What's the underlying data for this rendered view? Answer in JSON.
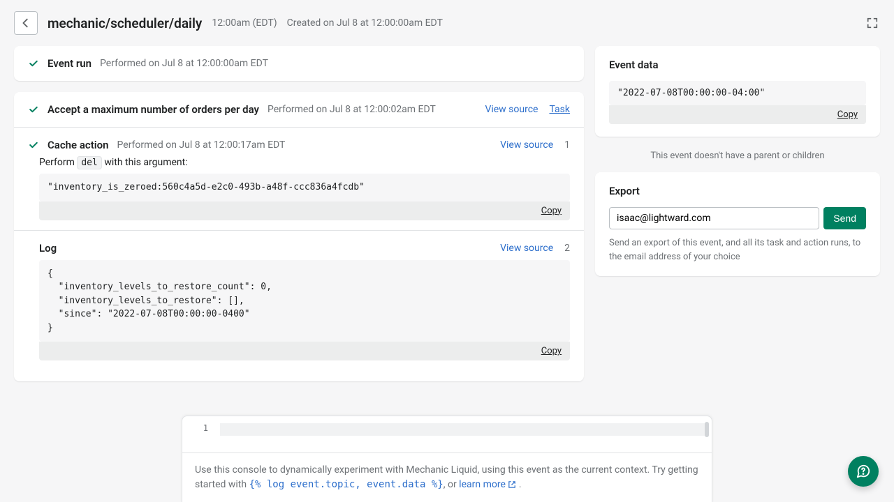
{
  "header": {
    "title": "mechanic/scheduler/daily",
    "time": "12:00am (EDT)",
    "created": "Created on Jul 8 at 12:00:00am EDT"
  },
  "event_run": {
    "title": "Event run",
    "performed": "Performed on Jul 8 at 12:00:00am EDT"
  },
  "task_run": {
    "title": "Accept a maximum number of orders per day",
    "performed": "Performed on Jul 8 at 12:00:02am EDT",
    "view_source": "View source",
    "task_link": "Task"
  },
  "cache_action": {
    "title": "Cache action",
    "performed": "Performed on Jul 8 at 12:00:17am EDT",
    "view_source": "View source",
    "count": "1",
    "arg_prefix": "Perform ",
    "arg_op": "del",
    "arg_suffix": " with this argument:",
    "arg_value": "\"inventory_is_zeroed:560c4a5d-e2c0-493b-a48f-ccc836a4fcdb\"",
    "copy": "Copy"
  },
  "log": {
    "title": "Log",
    "view_source": "View source",
    "count": "2",
    "body": "{\n  \"inventory_levels_to_restore_count\": 0,\n  \"inventory_levels_to_restore\": [],\n  \"since\": \"2022-07-08T00:00:00-0400\"\n}",
    "copy": "Copy"
  },
  "event_data": {
    "title": "Event data",
    "value": "\"2022-07-08T00:00:00-04:00\"",
    "copy": "Copy",
    "parent_note": "This event doesn't have a parent or children"
  },
  "export": {
    "title": "Export",
    "email": "isaac@lightward.com",
    "send": "Send",
    "help": "Send an export of this event, and all its task and action runs, to the email address of your choice"
  },
  "console": {
    "line_no": "1",
    "help_prefix": "Use this console to dynamically experiment with Mechanic Liquid, using this event as the current context. Try getting started with ",
    "snippet": "{% log event.topic, event.data %}",
    "help_mid": ", or ",
    "learn_more": "learn more",
    "help_suffix": " ."
  }
}
